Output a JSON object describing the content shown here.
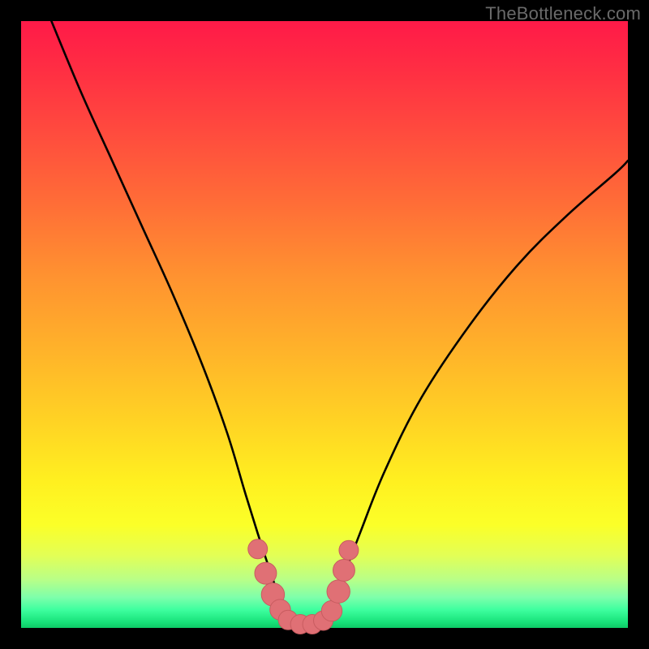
{
  "watermark": "TheBottleneck.com",
  "colors": {
    "frame": "#000000",
    "curve": "#000000",
    "marker_fill": "#e07075",
    "marker_stroke": "#c85c60"
  },
  "chart_data": {
    "type": "line",
    "title": "",
    "xlabel": "",
    "ylabel": "",
    "xlim": [
      0,
      100
    ],
    "ylim": [
      0,
      100
    ],
    "series": [
      {
        "name": "left-curve",
        "x": [
          5,
          10,
          15,
          20,
          25,
          30,
          34,
          37,
          39.5,
          41.5,
          43.5
        ],
        "y": [
          100,
          88,
          77,
          66,
          55,
          43,
          32,
          22,
          14,
          8,
          2
        ]
      },
      {
        "name": "right-curve",
        "x": [
          51,
          53,
          56,
          60,
          66,
          74,
          82,
          90,
          98,
          100
        ],
        "y": [
          2,
          8,
          16,
          26,
          38,
          50,
          60,
          68,
          75,
          77
        ]
      },
      {
        "name": "valley-floor",
        "x": [
          43.5,
          45,
          47,
          49,
          51
        ],
        "y": [
          2,
          0.8,
          0.5,
          0.8,
          2
        ]
      }
    ],
    "markers": [
      {
        "x": 39.0,
        "y": 13.0,
        "r": 1.6
      },
      {
        "x": 40.3,
        "y": 9.0,
        "r": 1.8
      },
      {
        "x": 41.5,
        "y": 5.5,
        "r": 1.9
      },
      {
        "x": 42.7,
        "y": 3.0,
        "r": 1.7
      },
      {
        "x": 44.0,
        "y": 1.3,
        "r": 1.6
      },
      {
        "x": 46.0,
        "y": 0.6,
        "r": 1.6
      },
      {
        "x": 48.0,
        "y": 0.6,
        "r": 1.6
      },
      {
        "x": 49.8,
        "y": 1.2,
        "r": 1.6
      },
      {
        "x": 51.2,
        "y": 2.8,
        "r": 1.7
      },
      {
        "x": 52.3,
        "y": 6.0,
        "r": 1.9
      },
      {
        "x": 53.2,
        "y": 9.5,
        "r": 1.8
      },
      {
        "x": 54.0,
        "y": 12.8,
        "r": 1.6
      }
    ]
  }
}
